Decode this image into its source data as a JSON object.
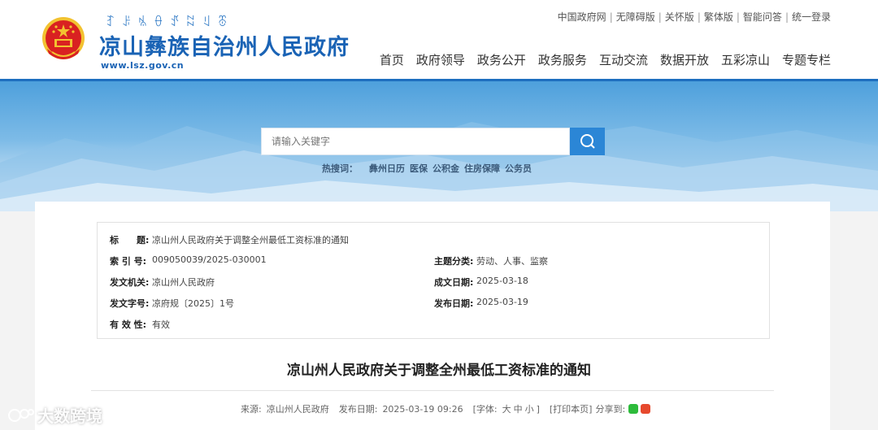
{
  "header": {
    "yi_title": "ꆈꌠꁱꂷꀋꉆꆹꁨ",
    "site_name": "凉山彝族自治州人民政府",
    "site_url": "www.lsz.gov.cn"
  },
  "toplinks": [
    "中国政府网",
    "无障碍版",
    "关怀版",
    "繁体版",
    "智能问答",
    "统一登录"
  ],
  "nav": [
    "首页",
    "政府领导",
    "政务公开",
    "政务服务",
    "互动交流",
    "数据开放",
    "五彩凉山",
    "专题专栏"
  ],
  "search": {
    "placeholder": "请输入关键字",
    "hot_label": "热搜词：",
    "hot_words": [
      "彝州日历",
      "医保",
      "公积金",
      "住房保障",
      "公务员"
    ]
  },
  "meta": {
    "title_key": "标　　题:",
    "title_val": "凉山州人民政府关于调整全州最低工资标准的通知",
    "index_key": "索 引 号:",
    "index_val": "009050039/2025-030001",
    "topic_key": "主题分类:",
    "topic_val": "劳动、人事、监察",
    "issuer_key": "发文机关:",
    "issuer_val": "凉山州人民政府",
    "formed_key": "成文日期:",
    "formed_val": "2025-03-18",
    "docno_key": "发文字号:",
    "docno_val": "凉府规〔2025〕1号",
    "published_key": "发布日期:",
    "published_val": "2025-03-19",
    "valid_key": "有 效 性:",
    "valid_val": "有效"
  },
  "doc_title": "凉山州人民政府关于调整全州最低工资标准的通知",
  "info": {
    "source_label": "来源:",
    "source_val": "凉山州人民政府",
    "date_label": "发布日期:",
    "date_val": "2025-03-19 09:26",
    "font_label": "[字体:",
    "font_large": "大",
    "font_mid": "中",
    "font_small": "小",
    "font_close": "]",
    "print": "[打印本页]",
    "share": "分享到:"
  },
  "watermark": "大数跨境",
  "colors": {
    "brand_blue": "#1a63b5",
    "search_button": "#2b86d6",
    "emblem_red": "#d92121",
    "emblem_gold": "#f2c230"
  }
}
